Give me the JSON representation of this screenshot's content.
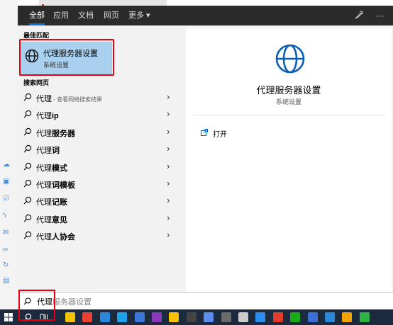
{
  "tabs": [
    "全部",
    "应用",
    "文档",
    "网页",
    "更多 ▾"
  ],
  "best_match": {
    "section_label": "最佳匹配",
    "title": "代理服务器设置",
    "subtitle": "系统设置"
  },
  "web": {
    "section_label": "搜索网页",
    "items": [
      {
        "prefix": "代理",
        "bold": "",
        "suffix": " - 查看网络搜索结果"
      },
      {
        "prefix": "代理",
        "bold": "ip",
        "suffix": ""
      },
      {
        "prefix": "代理",
        "bold": "服务器",
        "suffix": ""
      },
      {
        "prefix": "代理",
        "bold": "词",
        "suffix": ""
      },
      {
        "prefix": "代理",
        "bold": "模式",
        "suffix": ""
      },
      {
        "prefix": "代理",
        "bold": "词模板",
        "suffix": ""
      },
      {
        "prefix": "代理",
        "bold": "记账",
        "suffix": ""
      },
      {
        "prefix": "代理",
        "bold": "意见",
        "suffix": ""
      },
      {
        "prefix": "代理",
        "bold": "人协会",
        "suffix": ""
      }
    ]
  },
  "preview": {
    "title": "代理服务器设置",
    "subtitle": "系统设置",
    "open_label": "打开"
  },
  "search": {
    "typed": "代理",
    "completion": "服务器设置"
  },
  "taskbar_colors": [
    "#f4c300",
    "#e94235",
    "#2b88d8",
    "#1fa3e8",
    "#3c78d8",
    "#8a3ab9",
    "#f9c200",
    "#444",
    "#5b8def",
    "#6b6b6b",
    "#cccccc",
    "#2d8cf0",
    "#e43b2c",
    "#1aad19",
    "#3c6fd8",
    "#2b88d8",
    "#f4a300",
    "#2fb344"
  ]
}
